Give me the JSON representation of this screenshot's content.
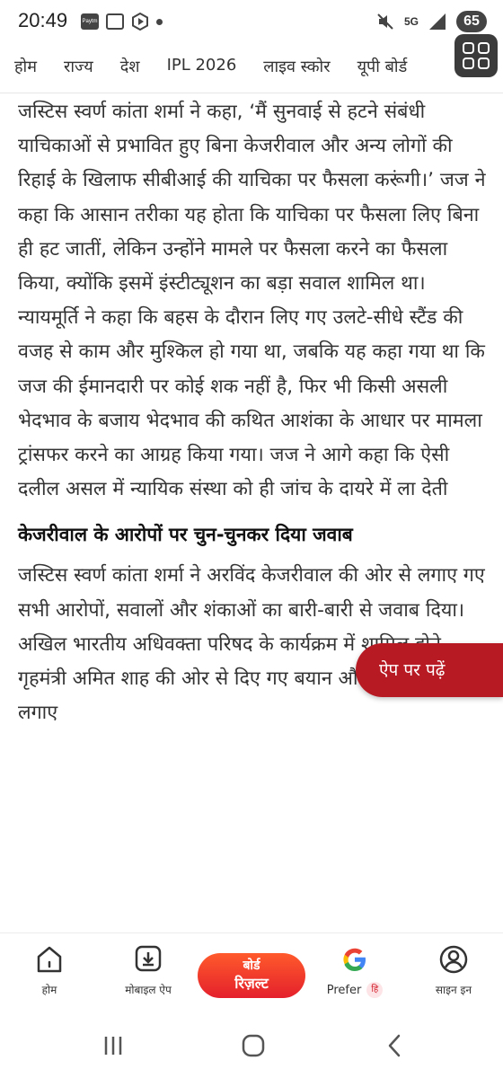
{
  "status_bar": {
    "time": "20:49",
    "left_icons": [
      "paytm-icon",
      "scan-icon",
      "media-icon",
      "dot-icon"
    ],
    "network": "5G",
    "battery": "65"
  },
  "category_nav": {
    "items": [
      "होम",
      "राज्य",
      "देश",
      "IPL 2026",
      "लाइव स्कोर",
      "यूपी बोर्ड"
    ]
  },
  "article": {
    "paragraph_1": "जस्टिस स्वर्ण कांता शर्मा ने कहा, ‘मैं सुनवाई से हटने संबंधी याचिकाओं से प्रभावित हुए बिना केजरीवाल और अन्य लोगों की रिहाई के खिलाफ सीबीआई की याचिका पर फैसला करूंगी।’ जज ने कहा कि आसान तरीका यह होता कि याचिका पर फैसला लिए बिना ही हट जातीं, लेकिन उन्होंने मामले पर फैसला करने का फैसला किया, क्योंकि इसमें इंस्टीट्यूशन का बड़ा सवाल शामिल था। न्यायमूर्ति ने कहा कि बहस के दौरान लिए गए उलटे-सीधे स्टैंड की वजह से काम और मुश्किल हो गया था, जबकि यह कहा गया था कि जज की ईमानदारी पर कोई शक नहीं है, फिर भी किसी असली भेदभाव के बजाय भेदभाव की कथित आशंका के आधार पर मामला ट्रांसफर करने का आग्रह किया गया। जज ने आगे कहा कि ऐसी दलील असल में न्यायिक संस्था को ही जांच के दायरे में ला देती",
    "heading": "केजरीवाल के आरोपों पर चुन-चुनकर दिया जवाब",
    "paragraph_2": "जस्टिस स्वर्ण कांता शर्मा ने अरविंद केजरीवाल की ओर से लगाए गए सभी आरोपों, सवालों और शंकाओं का बारी-बारी से जवाब दिया। अखिल भारतीय अधिवक्ता परिषद के कार्यक्रम में शामिल होने, गृहमंत्री अमित शाह की ओर से दिए गए बयान और बच्चों को लेकर लगाए"
  },
  "app_cta": {
    "label": "ऐप पर पढ़ें"
  },
  "bottom_nav": {
    "home": "होम",
    "mobile_app": "मोबाइल ऐप",
    "result_line1": "बोर्ड",
    "result_line2": "रिज़ल्ट",
    "prefer": "Prefer",
    "prefer_badge": "हि",
    "sign_in": "साइन इन"
  },
  "colors": {
    "accent_red": "#b81a24",
    "result_gradient_top": "#ff5a2c",
    "result_gradient_bottom": "#e4202c"
  }
}
